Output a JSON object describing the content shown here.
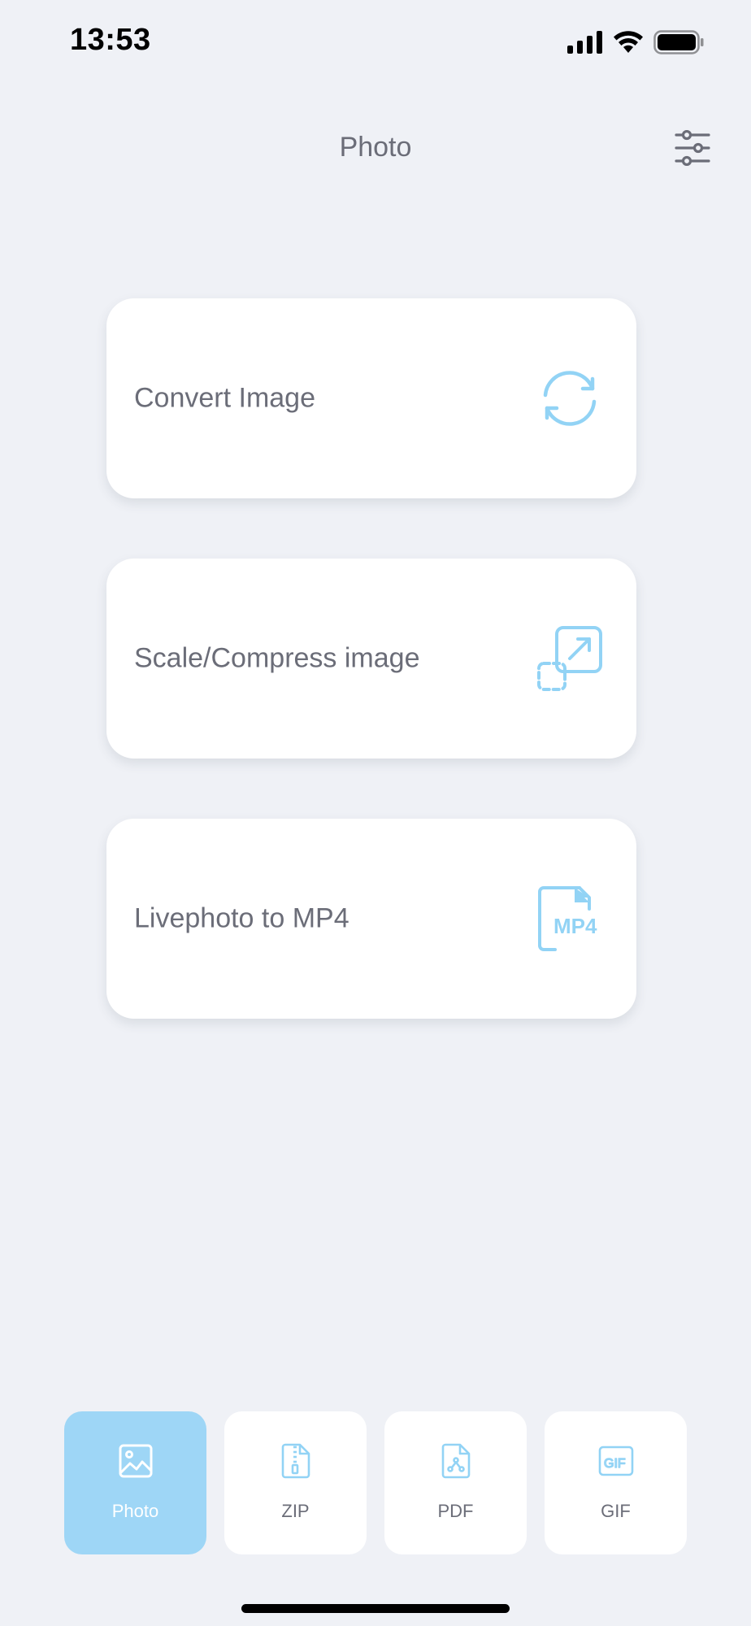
{
  "status_bar": {
    "time": "13:53",
    "icons": [
      "cellular-signal-icon",
      "wifi-icon",
      "battery-icon"
    ]
  },
  "header": {
    "title": "Photo",
    "settings_icon": "sliders-icon"
  },
  "cards": [
    {
      "label": "Convert Image",
      "icon": "refresh-icon"
    },
    {
      "label": "Scale/Compress image",
      "icon": "resize-icon"
    },
    {
      "label": "Livephoto to MP4",
      "icon": "mp4-file-icon"
    }
  ],
  "tabs": [
    {
      "label": "Photo",
      "icon": "image-icon",
      "active": true
    },
    {
      "label": "ZIP",
      "icon": "zip-file-icon",
      "active": false
    },
    {
      "label": "PDF",
      "icon": "pdf-file-icon",
      "active": false
    },
    {
      "label": "GIF",
      "icon": "gif-icon",
      "active": false
    }
  ],
  "colors": {
    "background": "#eff1f6",
    "accent": "#9ed6f6",
    "icon_blue": "#92d3f5",
    "text": "#6b6d78"
  }
}
